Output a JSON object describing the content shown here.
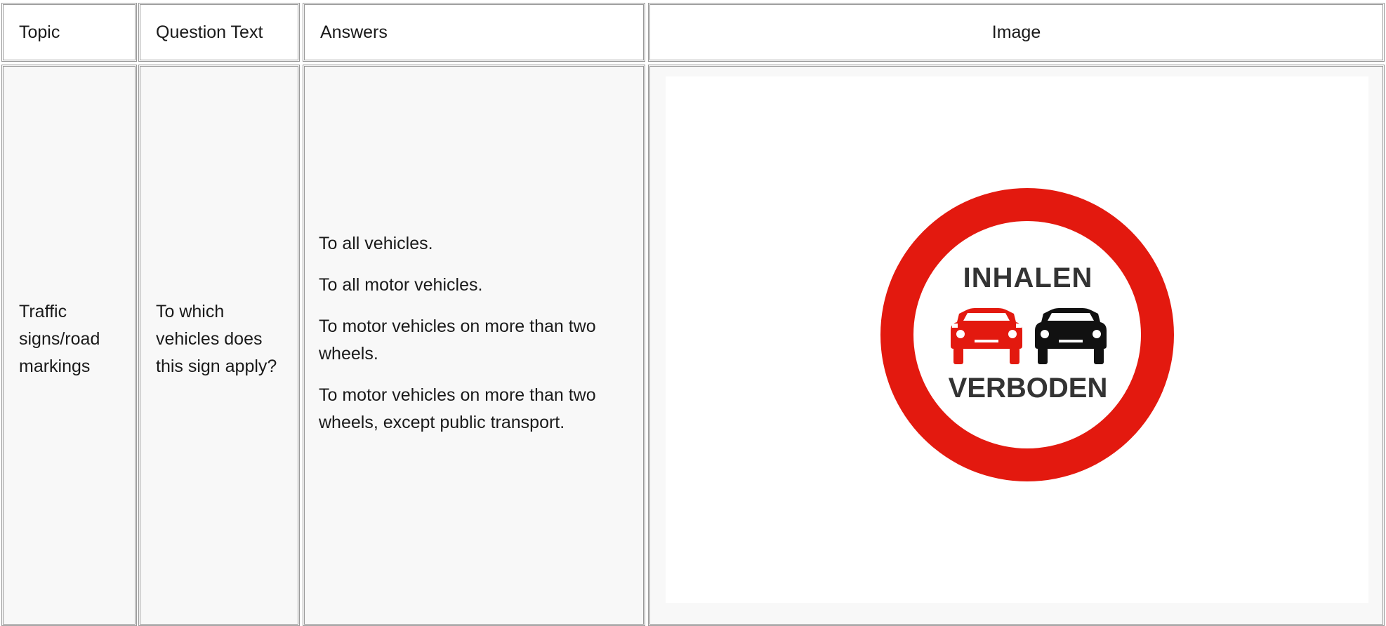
{
  "headers": {
    "topic": "Topic",
    "question": "Question Text",
    "answers": "Answers",
    "image": "Image"
  },
  "row": {
    "topic": "Traffic signs/road markings",
    "question": "To which vehicles does this sign apply?",
    "answers": [
      "To all vehicles.",
      "To all motor vehicles.",
      "To motor vehicles on more than two wheels.",
      "To motor vehicles on more than two wheels, except public transport."
    ],
    "sign": {
      "icon": "no-overtaking-sign-icon",
      "top_text": "INHALEN",
      "bottom_text": "VERBODEN",
      "ring_color": "#e3190f",
      "left_car_color": "#e3190f",
      "right_car_color": "#111111"
    }
  }
}
